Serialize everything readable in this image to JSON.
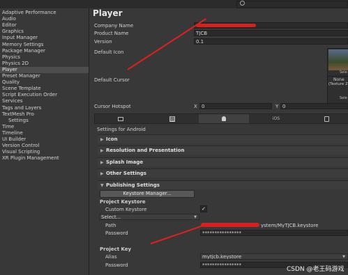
{
  "sidebar": {
    "items": [
      {
        "label": "Adaptive Performance",
        "sub": false,
        "sel": false
      },
      {
        "label": "Audio",
        "sub": false,
        "sel": false
      },
      {
        "label": "Editor",
        "sub": false,
        "sel": false
      },
      {
        "label": "Graphics",
        "sub": false,
        "sel": false
      },
      {
        "label": "Input Manager",
        "sub": false,
        "sel": false
      },
      {
        "label": "Memory Settings",
        "sub": false,
        "sel": false
      },
      {
        "label": "Package Manager",
        "sub": false,
        "sel": false
      },
      {
        "label": "Physics",
        "sub": false,
        "sel": false
      },
      {
        "label": "Physics 2D",
        "sub": false,
        "sel": false
      },
      {
        "label": "Player",
        "sub": false,
        "sel": true
      },
      {
        "label": "Preset Manager",
        "sub": false,
        "sel": false
      },
      {
        "label": "Quality",
        "sub": false,
        "sel": false
      },
      {
        "label": "Scene Template",
        "sub": false,
        "sel": false
      },
      {
        "label": "Script Execution Order",
        "sub": false,
        "sel": false
      },
      {
        "label": "Services",
        "sub": false,
        "sel": false
      },
      {
        "label": "Tags and Layers",
        "sub": false,
        "sel": false
      },
      {
        "label": "TextMesh Pro",
        "sub": false,
        "sel": false
      },
      {
        "label": "Settings",
        "sub": true,
        "sel": false
      },
      {
        "label": "Time",
        "sub": false,
        "sel": false
      },
      {
        "label": "Timeline",
        "sub": false,
        "sel": false
      },
      {
        "label": "UI Builder",
        "sub": false,
        "sel": false
      },
      {
        "label": "Version Control",
        "sub": false,
        "sel": false
      },
      {
        "label": "Visual Scripting",
        "sub": false,
        "sel": false
      },
      {
        "label": "XR Plugin Management",
        "sub": false,
        "sel": false
      }
    ]
  },
  "main": {
    "title": "Player",
    "company_label": "Company Name",
    "company_value": "",
    "product_label": "Product Name",
    "product_value": "TJCB",
    "version_label": "Version",
    "version_value": "0.1",
    "default_icon_label": "Default Icon",
    "default_cursor_label": "Default Cursor",
    "cursor_none": "None",
    "cursor_texture": "(Texture 2",
    "cursor_select": "Sele",
    "icon_select": "Sele",
    "hotspot_label": "Cursor Hotspot",
    "hotspot_x_label": "X",
    "hotspot_x": "0",
    "hotspot_y_label": "Y",
    "hotspot_y": "0",
    "tab_ios": "iOS",
    "settings_for": "Settings for Android",
    "sections": [
      "Icon",
      "Resolution and Presentation",
      "Splash Image",
      "Other Settings"
    ],
    "publishing": {
      "header": "Publishing Settings",
      "keystore_manager": "Keystore Manager...",
      "project_keystore": "Project Keystore",
      "custom_keystore": "Custom Keystore",
      "custom_keystore_checked": "✓",
      "select": "Select...",
      "path_label": "Path",
      "path_value": "ystem/MyTJCB.keystore",
      "password_label": "Password",
      "password_value": "****************",
      "project_key": "Project Key",
      "alias_label": "Alias",
      "alias_value": "mytjcb.keystore",
      "key_password_label": "Password",
      "key_password_value": "****************"
    }
  },
  "watermark": "CSDN @老王码游戏",
  "colors": {
    "annotation": "#e02020",
    "selected": "#4d4d4d"
  }
}
